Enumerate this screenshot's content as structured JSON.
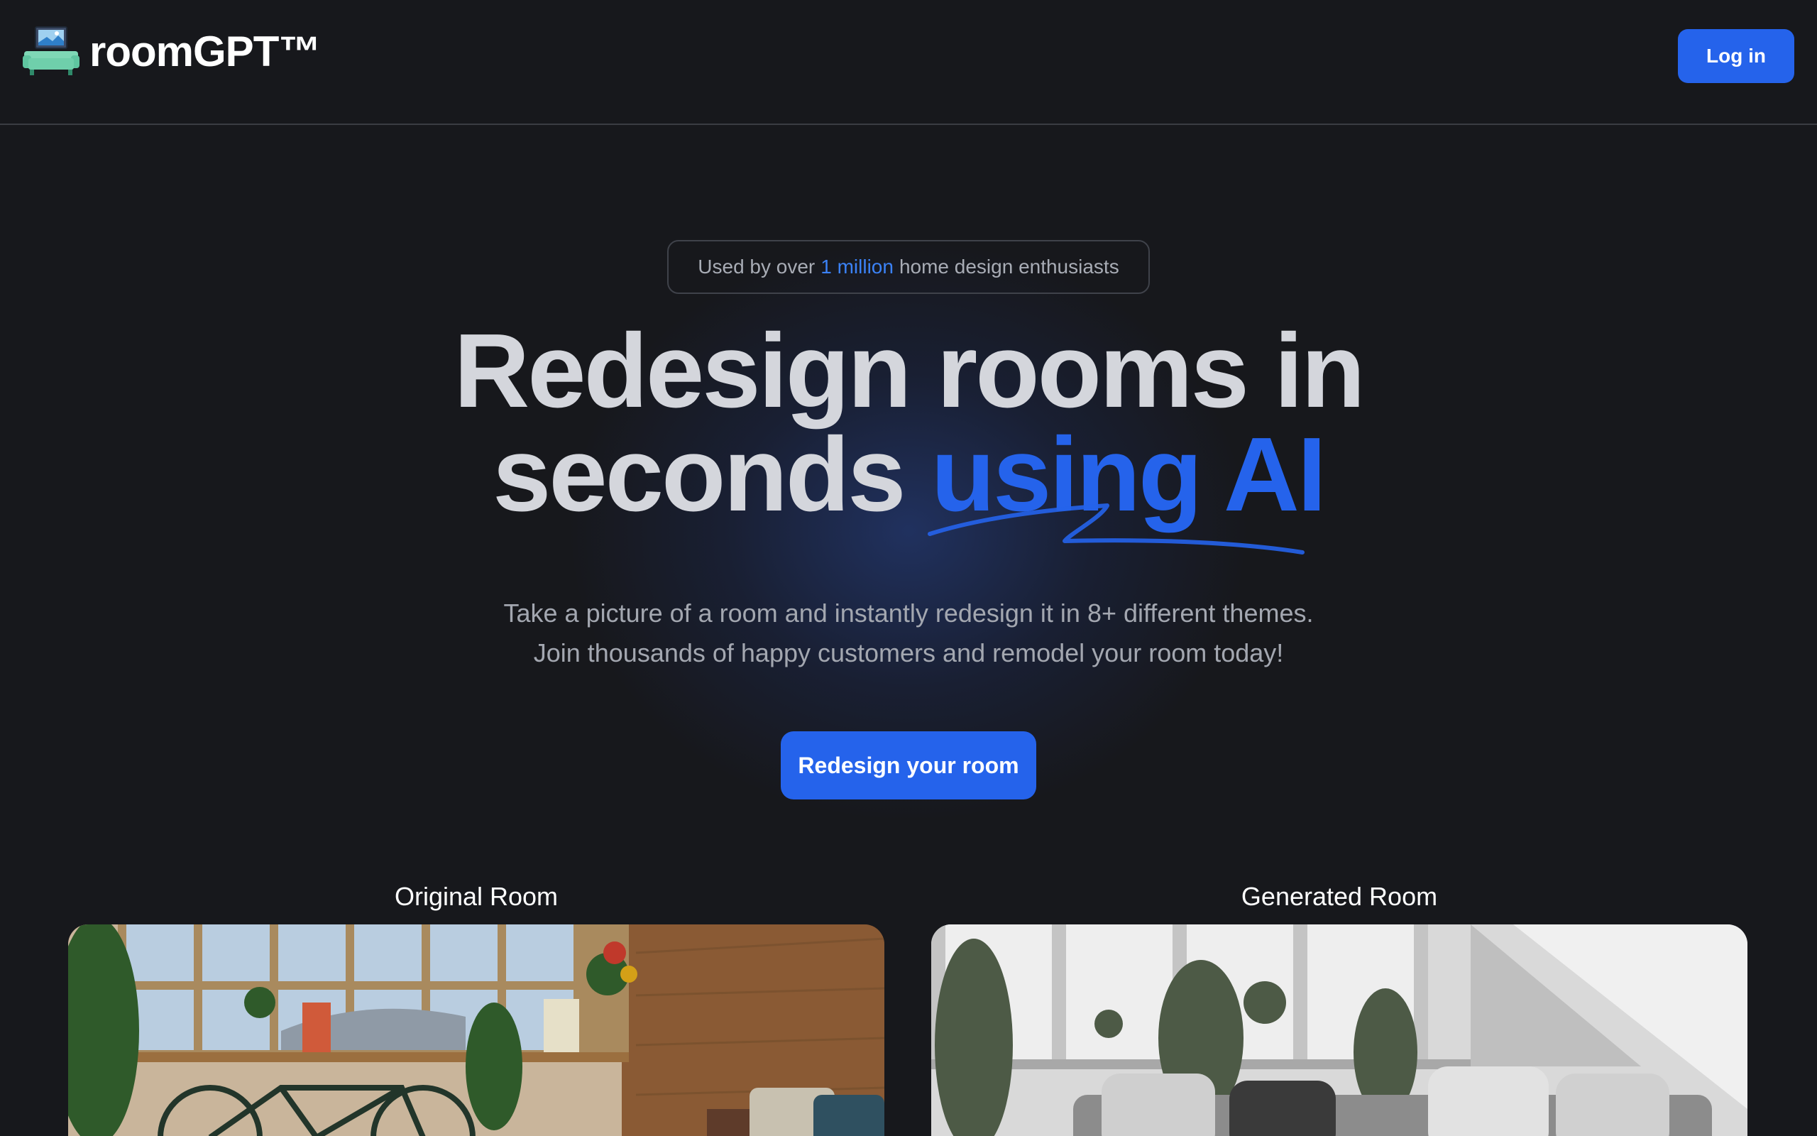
{
  "header": {
    "brand_name": "roomGPT™",
    "login_label": "Log in"
  },
  "hero": {
    "badge_prefix": "Used by over",
    "badge_highlight": "1 million",
    "badge_suffix": "home design enthusiasts",
    "headline_line1": "Redesign rooms in",
    "headline_line2_plain": "seconds",
    "headline_line2_accent": "using AI",
    "subtext_line1": "Take a picture of a room and instantly redesign it in 8+ different themes.",
    "subtext_line2": "Join thousands of happy customers and remodel your room today!",
    "cta_label": "Redesign your room"
  },
  "comparison": {
    "original_label": "Original Room",
    "generated_label": "Generated Room"
  },
  "colors": {
    "background": "#17181c",
    "accent": "#2563eb",
    "logo_teal": "#5fc5a0"
  },
  "icons": {
    "logo": "sofa-with-picture-icon",
    "underline": "squiggle-underline-icon"
  }
}
